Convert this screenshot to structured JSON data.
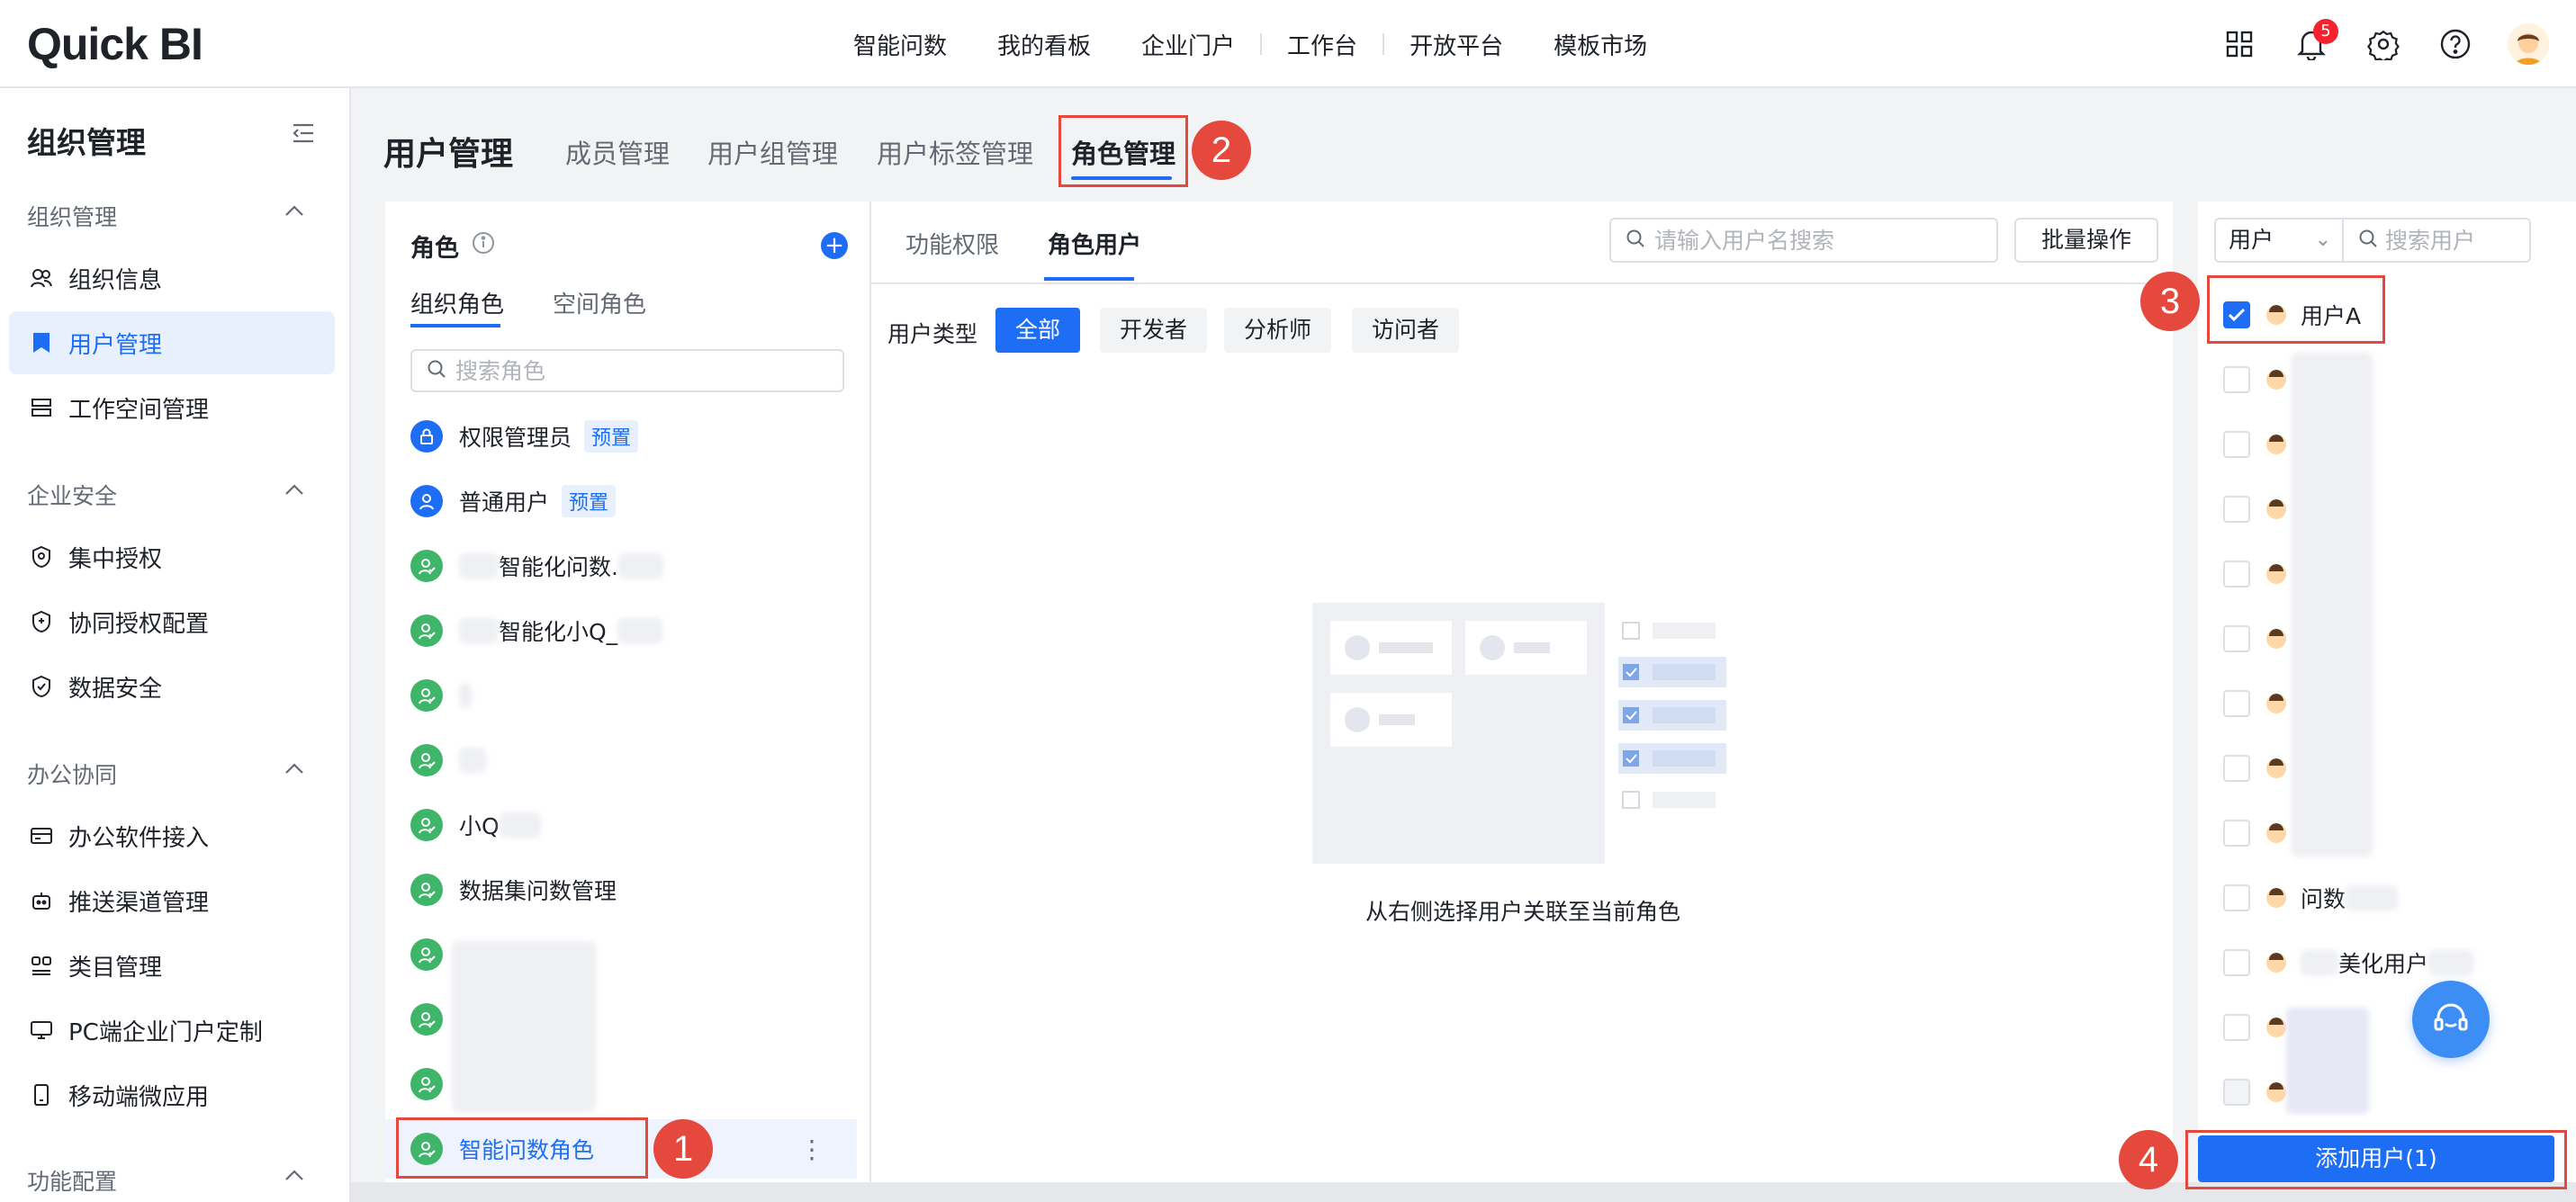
{
  "app": {
    "logo": "Quick BI"
  },
  "topnav": {
    "items": [
      "智能问数",
      "我的看板",
      "企业门户",
      "工作台",
      "开放平台",
      "模板市场"
    ],
    "notification_count": "5"
  },
  "sidebar": {
    "title": "组织管理",
    "groups": [
      {
        "label": "组织管理",
        "items": [
          "组织信息",
          "用户管理",
          "工作空间管理"
        ]
      },
      {
        "label": "企业安全",
        "items": [
          "集中授权",
          "协同授权配置",
          "数据安全"
        ]
      },
      {
        "label": "办公协同",
        "items": [
          "办公软件接入",
          "推送渠道管理",
          "类目管理",
          "PC端企业门户定制",
          "移动端微应用"
        ]
      },
      {
        "label": "功能配置"
      }
    ],
    "active_item": "用户管理"
  },
  "page": {
    "title": "用户管理",
    "tabs": [
      "成员管理",
      "用户组管理",
      "用户标签管理",
      "角色管理"
    ],
    "active_tab": "角色管理"
  },
  "role_panel": {
    "title": "角色",
    "tabs": [
      "组织角色",
      "空间角色"
    ],
    "search_placeholder": "搜索角色",
    "roles": [
      {
        "name": "权限管理员",
        "tag": "预置"
      },
      {
        "name": "普通用户",
        "tag": "预置"
      },
      {
        "name": "智能化问数."
      },
      {
        "name": "智能化小Q_"
      },
      {
        "name": ""
      },
      {
        "name": ""
      },
      {
        "name": "小Q"
      },
      {
        "name": "数据集问数管理"
      },
      {
        "name": ""
      },
      {
        "name": ""
      },
      {
        "name": ""
      },
      {
        "name": "智能问数角色"
      }
    ]
  },
  "mid_panel": {
    "tabs": [
      "功能权限",
      "角色用户"
    ],
    "search_placeholder": "请输入用户名搜索",
    "batch_button": "批量操作",
    "user_type_label": "用户类型",
    "filters": [
      "全部",
      "开发者",
      "分析师",
      "访问者"
    ],
    "empty_text": "从右侧选择用户关联至当前角色"
  },
  "right_panel": {
    "select_value": "用户",
    "search_placeholder": "搜索用户",
    "users": [
      {
        "name": "用户A",
        "checked": true
      },
      {
        "name": ""
      },
      {
        "name": ""
      },
      {
        "name": ""
      },
      {
        "name": ""
      },
      {
        "name": ""
      },
      {
        "name": ""
      },
      {
        "name": ""
      },
      {
        "name": ""
      },
      {
        "name": "问数"
      },
      {
        "name": "美化用户"
      },
      {
        "name": ""
      },
      {
        "name": ""
      }
    ],
    "add_button": "添加用户(1)"
  },
  "annotations": [
    "1",
    "2",
    "3",
    "4"
  ],
  "colors": {
    "accent": "#1d6ef5",
    "annotation": "#e5483c",
    "role_green": "#3fb56a"
  }
}
